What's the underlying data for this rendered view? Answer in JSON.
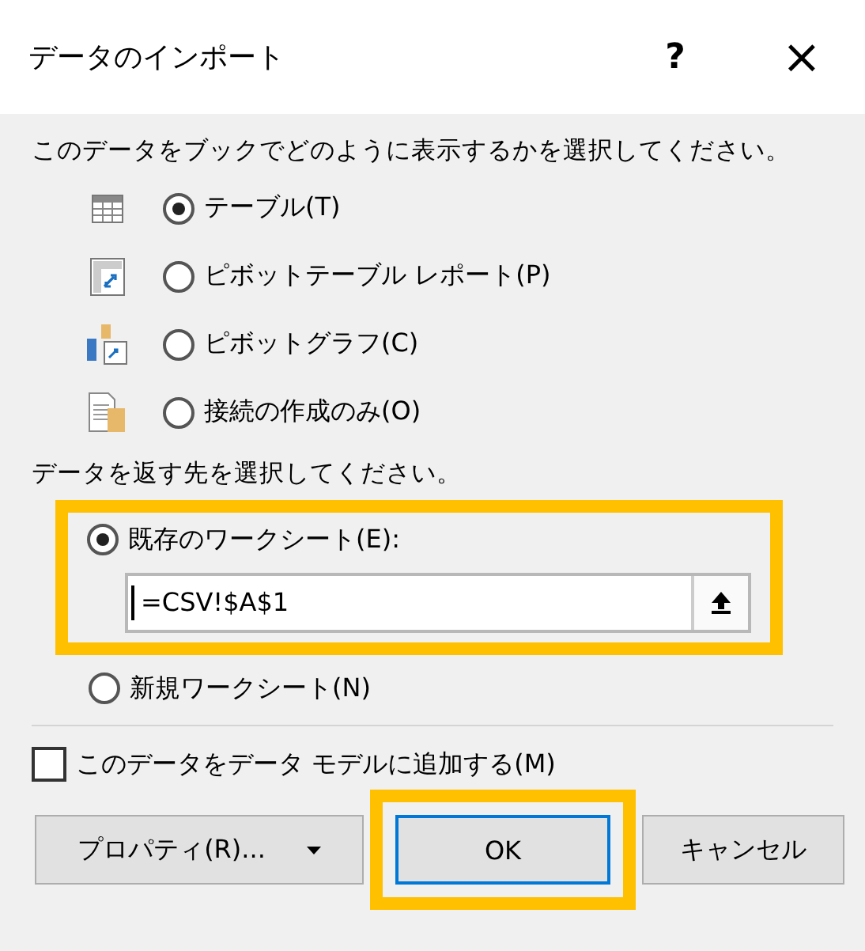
{
  "window": {
    "title": "データのインポート",
    "help": "?",
    "close": "×"
  },
  "view_prompt": "このデータをブックでどのように表示するかを選択してください。",
  "view_options": [
    {
      "kind": "table",
      "label": "テーブル(T)",
      "selected": true
    },
    {
      "kind": "pivot-table",
      "label": "ピボットテーブル レポート(P)",
      "selected": false
    },
    {
      "kind": "pivot-chart",
      "label": "ピボットグラフ(C)",
      "selected": false
    },
    {
      "kind": "connection",
      "label": "接続の作成のみ(O)",
      "selected": false
    }
  ],
  "destination_prompt": "データを返す先を選択してください。",
  "destination_options": [
    {
      "label": "既存のワークシート(E):",
      "selected": true,
      "highlighted": true,
      "field_value": "=CSV!$A$1"
    },
    {
      "label": "新規ワークシート(N)",
      "selected": false,
      "highlighted": false
    }
  ],
  "data_model_checkbox": {
    "label": "このデータをデータ モデルに追加する(M)",
    "checked": false
  },
  "buttons": [
    {
      "kind": "dropdown",
      "label": "プロパティ(R)...",
      "default": false,
      "highlighted": false
    },
    {
      "kind": "plain",
      "label": "OK",
      "default": true,
      "highlighted": true
    },
    {
      "kind": "plain",
      "label": "キャンセル",
      "default": false,
      "highlighted": false
    }
  ]
}
